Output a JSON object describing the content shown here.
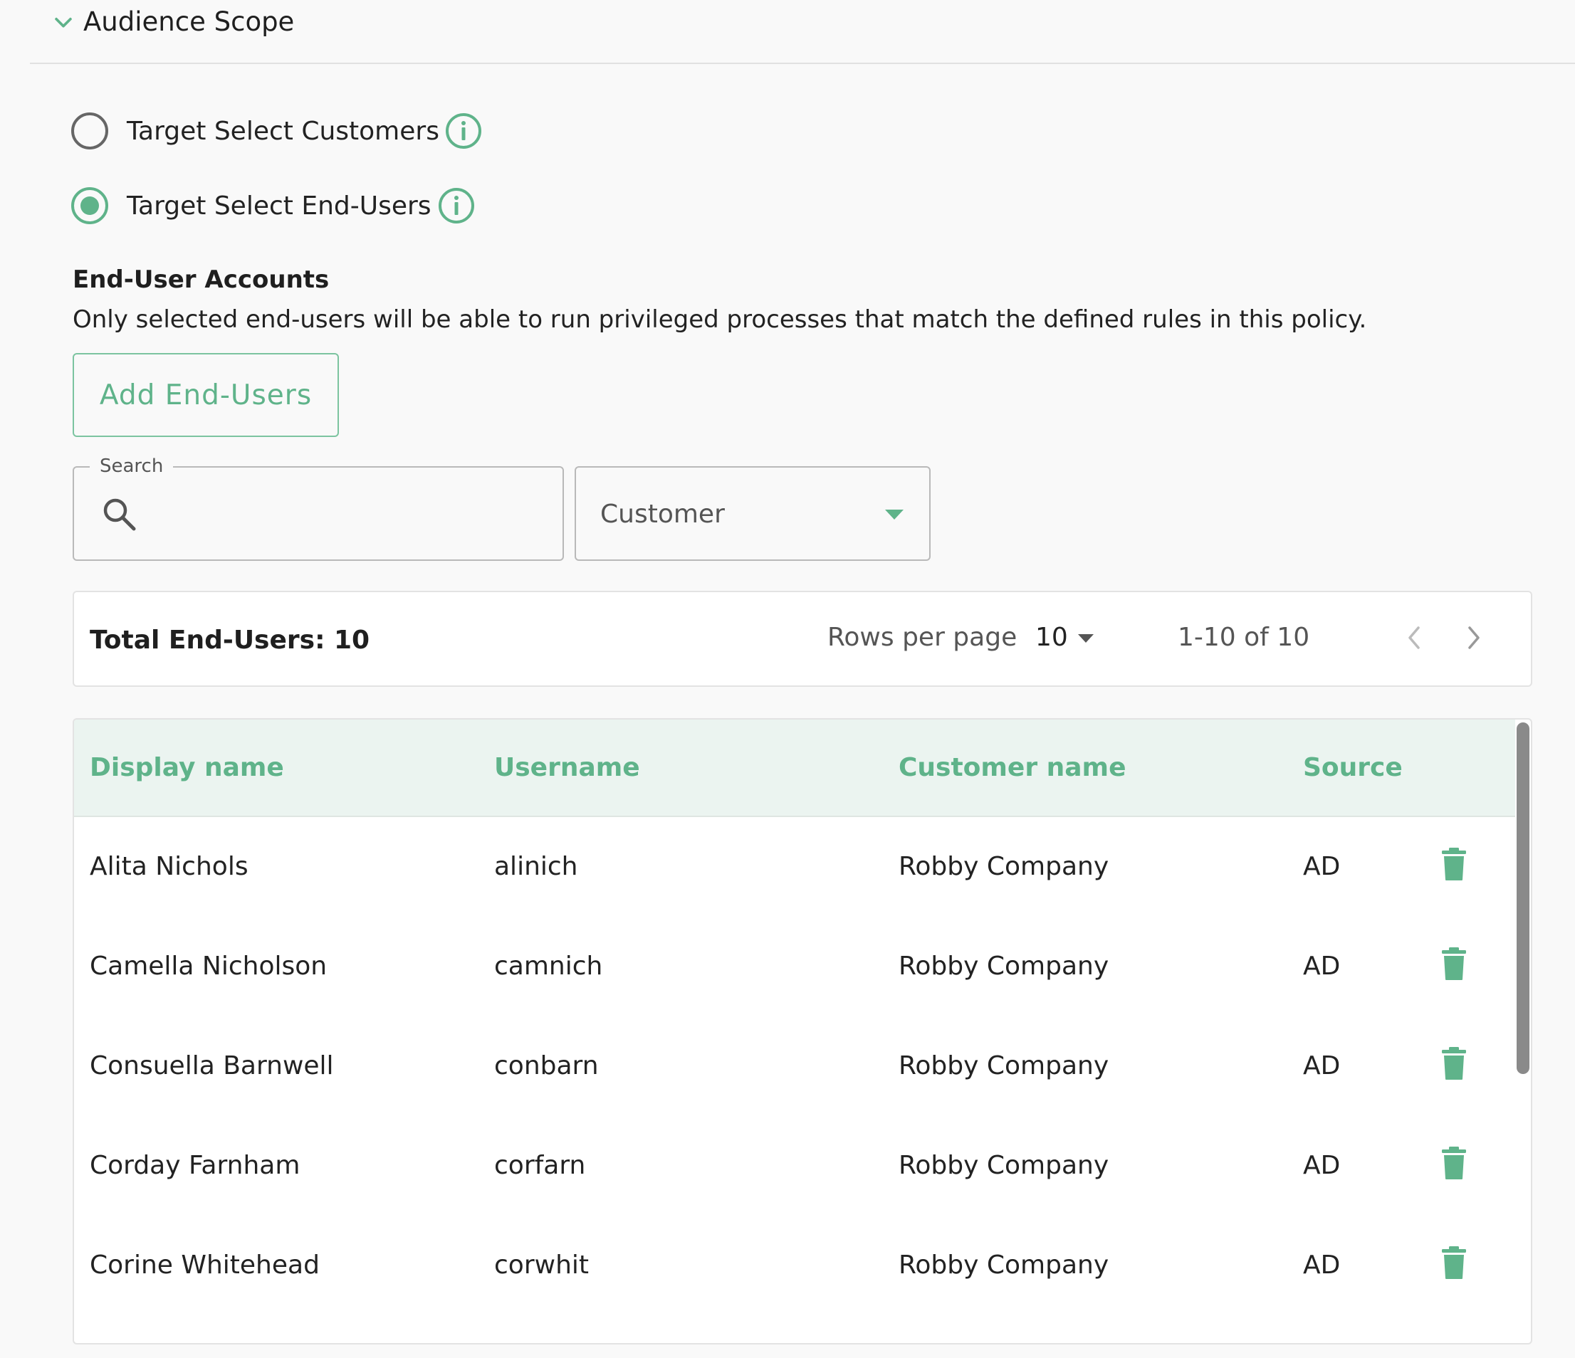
{
  "section": {
    "title": "Audience Scope",
    "expand_icon": "chevron-down-icon"
  },
  "audience_options": [
    {
      "label": "Target Select Customers",
      "selected": false
    },
    {
      "label": "Target Select End-Users",
      "selected": true
    }
  ],
  "accounts": {
    "title": "End-User Accounts",
    "description": "Only selected end-users will be able to run privileged processes that match the defined rules in this policy.",
    "add_button_label": "Add End-Users"
  },
  "filters": {
    "search_label": "Search",
    "search_value": "",
    "customer_select_value": "Customer"
  },
  "summary": {
    "total_label": "Total End-Users: 10",
    "rows_per_page_label": "Rows per page",
    "rows_per_page_value": "10",
    "range_label": "1-10 of 10"
  },
  "table": {
    "columns": [
      "Display name",
      "Username",
      "Customer name",
      "Source"
    ],
    "rows": [
      {
        "display_name": "Alita Nichols",
        "username": "alinich",
        "customer_name": "Robby Company",
        "source": "AD"
      },
      {
        "display_name": "Camella Nicholson",
        "username": "camnich",
        "customer_name": "Robby Company",
        "source": "AD"
      },
      {
        "display_name": "Consuella Barnwell",
        "username": "conbarn",
        "customer_name": "Robby Company",
        "source": "AD"
      },
      {
        "display_name": "Corday Farnham",
        "username": "corfarn",
        "customer_name": "Robby Company",
        "source": "AD"
      },
      {
        "display_name": "Corine Whitehead",
        "username": "corwhit",
        "customer_name": "Robby Company",
        "source": "AD"
      }
    ]
  },
  "colors": {
    "accent": "#5fb38a",
    "header_bg": "#ebf4f0",
    "page_bg": "#f9f9f9"
  }
}
